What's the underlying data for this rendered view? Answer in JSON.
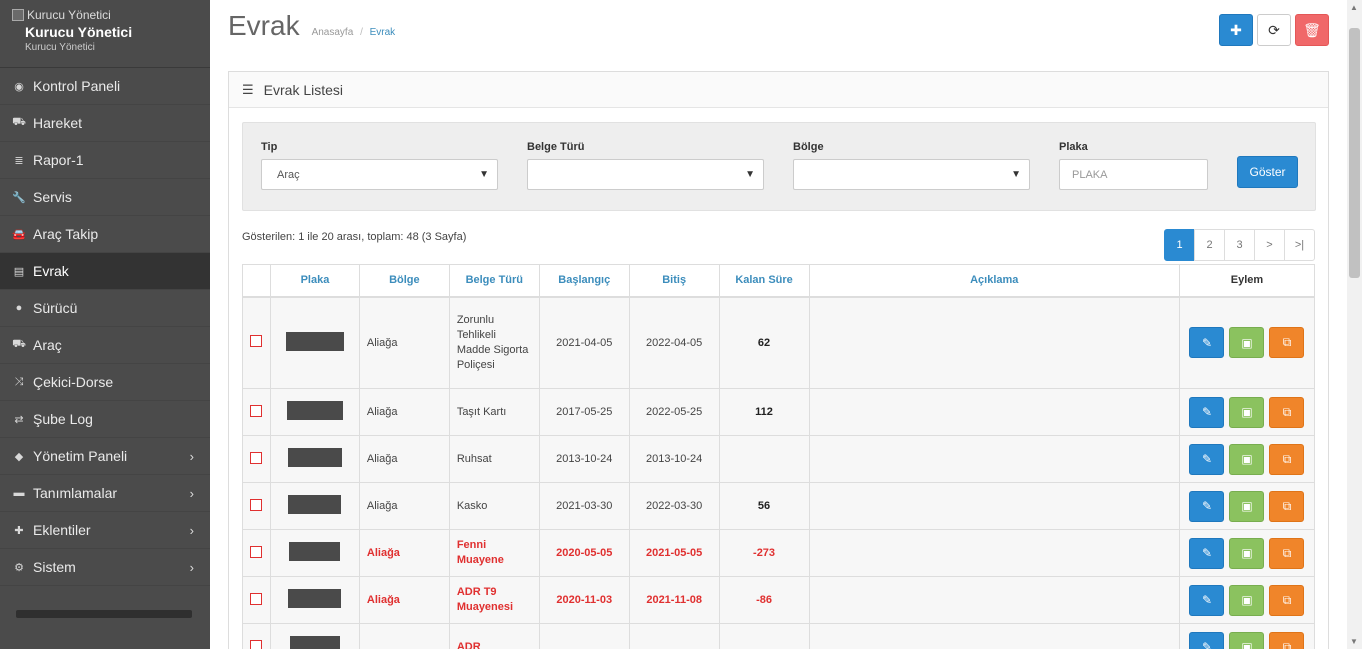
{
  "sidebar": {
    "logo_alt": "Kurucu Yönetici",
    "user_name": "Kurucu Yönetici",
    "user_role": "Kurucu Yönetici",
    "items": [
      {
        "label": "Kontrol Paneli",
        "icon": "dashboard-icon",
        "glyph": "◉",
        "active": false,
        "submenu": false
      },
      {
        "label": "Hareket",
        "icon": "truck-icon",
        "glyph": "⛟",
        "active": false,
        "submenu": false
      },
      {
        "label": "Rapor-1",
        "icon": "list-icon",
        "glyph": "≣",
        "active": false,
        "submenu": false
      },
      {
        "label": "Servis",
        "icon": "wrench-icon",
        "glyph": "🔧",
        "active": false,
        "submenu": false
      },
      {
        "label": "Araç Takip",
        "icon": "car-icon",
        "glyph": "🚘",
        "active": false,
        "submenu": false
      },
      {
        "label": "Evrak",
        "icon": "id-card-icon",
        "glyph": "▤",
        "active": true,
        "submenu": false
      },
      {
        "label": "Sürücü",
        "icon": "user-icon",
        "glyph": "●",
        "active": false,
        "submenu": false
      },
      {
        "label": "Araç",
        "icon": "truck-icon",
        "glyph": "⛟",
        "active": false,
        "submenu": false
      },
      {
        "label": "Çekici-Dorse",
        "icon": "random-icon",
        "glyph": "⤨",
        "active": false,
        "submenu": false
      },
      {
        "label": "Şube Log",
        "icon": "exchange-icon",
        "glyph": "⇄",
        "active": false,
        "submenu": false
      },
      {
        "label": "Yönetim Paneli",
        "icon": "tags-icon",
        "glyph": "◆",
        "active": false,
        "submenu": true
      },
      {
        "label": "Tanımlamalar",
        "icon": "folder-icon",
        "glyph": "▬",
        "active": false,
        "submenu": true
      },
      {
        "label": "Eklentiler",
        "icon": "puzzle-icon",
        "glyph": "✚",
        "active": false,
        "submenu": true
      },
      {
        "label": "Sistem",
        "icon": "gear-icon",
        "glyph": "⚙",
        "active": false,
        "submenu": true
      }
    ]
  },
  "header": {
    "title": "Evrak",
    "breadcrumb_home": "Anasayfa",
    "breadcrumb_sep": "/",
    "breadcrumb_current": "Evrak"
  },
  "panel": {
    "title": "Evrak Listesi"
  },
  "filters": {
    "tip_label": "Tip",
    "tip_value": "Araç",
    "belge_label": "Belge Türü",
    "belge_value": "",
    "bolge_label": "Bölge",
    "bolge_value": "",
    "plaka_label": "Plaka",
    "plaka_placeholder": "PLAKA",
    "show_button": "Göster"
  },
  "summary": "Gösterilen: 1 ile 20 arası, toplam: 48 (3 Sayfa)",
  "pagination": [
    "1",
    "2",
    "3",
    ">",
    ">|"
  ],
  "table": {
    "columns": [
      "",
      "Plaka",
      "Bölge",
      "Belge Türü",
      "Başlangıç",
      "Bitiş",
      "Kalan Süre",
      "Açıklama",
      "Eylem"
    ],
    "rows": [
      {
        "plaka_redacted": true,
        "bolge": "Aliağa",
        "belge": "Zorunlu Tehlikeli Madde Sigorta Poliçesi",
        "baslangic": "2021-04-05",
        "bitis": "2022-04-05",
        "kalan": "62",
        "aciklama": "",
        "expired": false
      },
      {
        "plaka_redacted": true,
        "bolge": "Aliağa",
        "belge": "Taşıt Kartı",
        "baslangic": "2017-05-25",
        "bitis": "2022-05-25",
        "kalan": "112",
        "aciklama": "",
        "expired": false
      },
      {
        "plaka_redacted": true,
        "bolge": "Aliağa",
        "belge": "Ruhsat",
        "baslangic": "2013-10-24",
        "bitis": "2013-10-24",
        "kalan": "",
        "aciklama": "",
        "expired": false
      },
      {
        "plaka_redacted": true,
        "bolge": "Aliağa",
        "belge": "Kasko",
        "baslangic": "2021-03-30",
        "bitis": "2022-03-30",
        "kalan": "56",
        "aciklama": "",
        "expired": false
      },
      {
        "plaka_redacted": true,
        "bolge": "Aliağa",
        "belge": "Fenni Muayene",
        "baslangic": "2020-05-05",
        "bitis": "2021-05-05",
        "kalan": "-273",
        "aciklama": "",
        "expired": true
      },
      {
        "plaka_redacted": true,
        "bolge": "Aliağa",
        "belge": "ADR T9 Muayenesi",
        "baslangic": "2020-11-03",
        "bitis": "2021-11-08",
        "kalan": "-86",
        "aciklama": "",
        "expired": true
      },
      {
        "plaka_redacted": true,
        "bolge": "",
        "belge": "ADR",
        "baslangic": "",
        "bitis": "",
        "kalan": "",
        "aciklama": "",
        "expired": true
      }
    ]
  },
  "colors": {
    "sidebar_bg": "#4b4b4b",
    "sidebar_active": "#333333",
    "primary": "#2a8ad2",
    "danger": "#f06869",
    "success": "#8bc25f",
    "warning": "#f0852a",
    "expired_text": "#e03030"
  }
}
